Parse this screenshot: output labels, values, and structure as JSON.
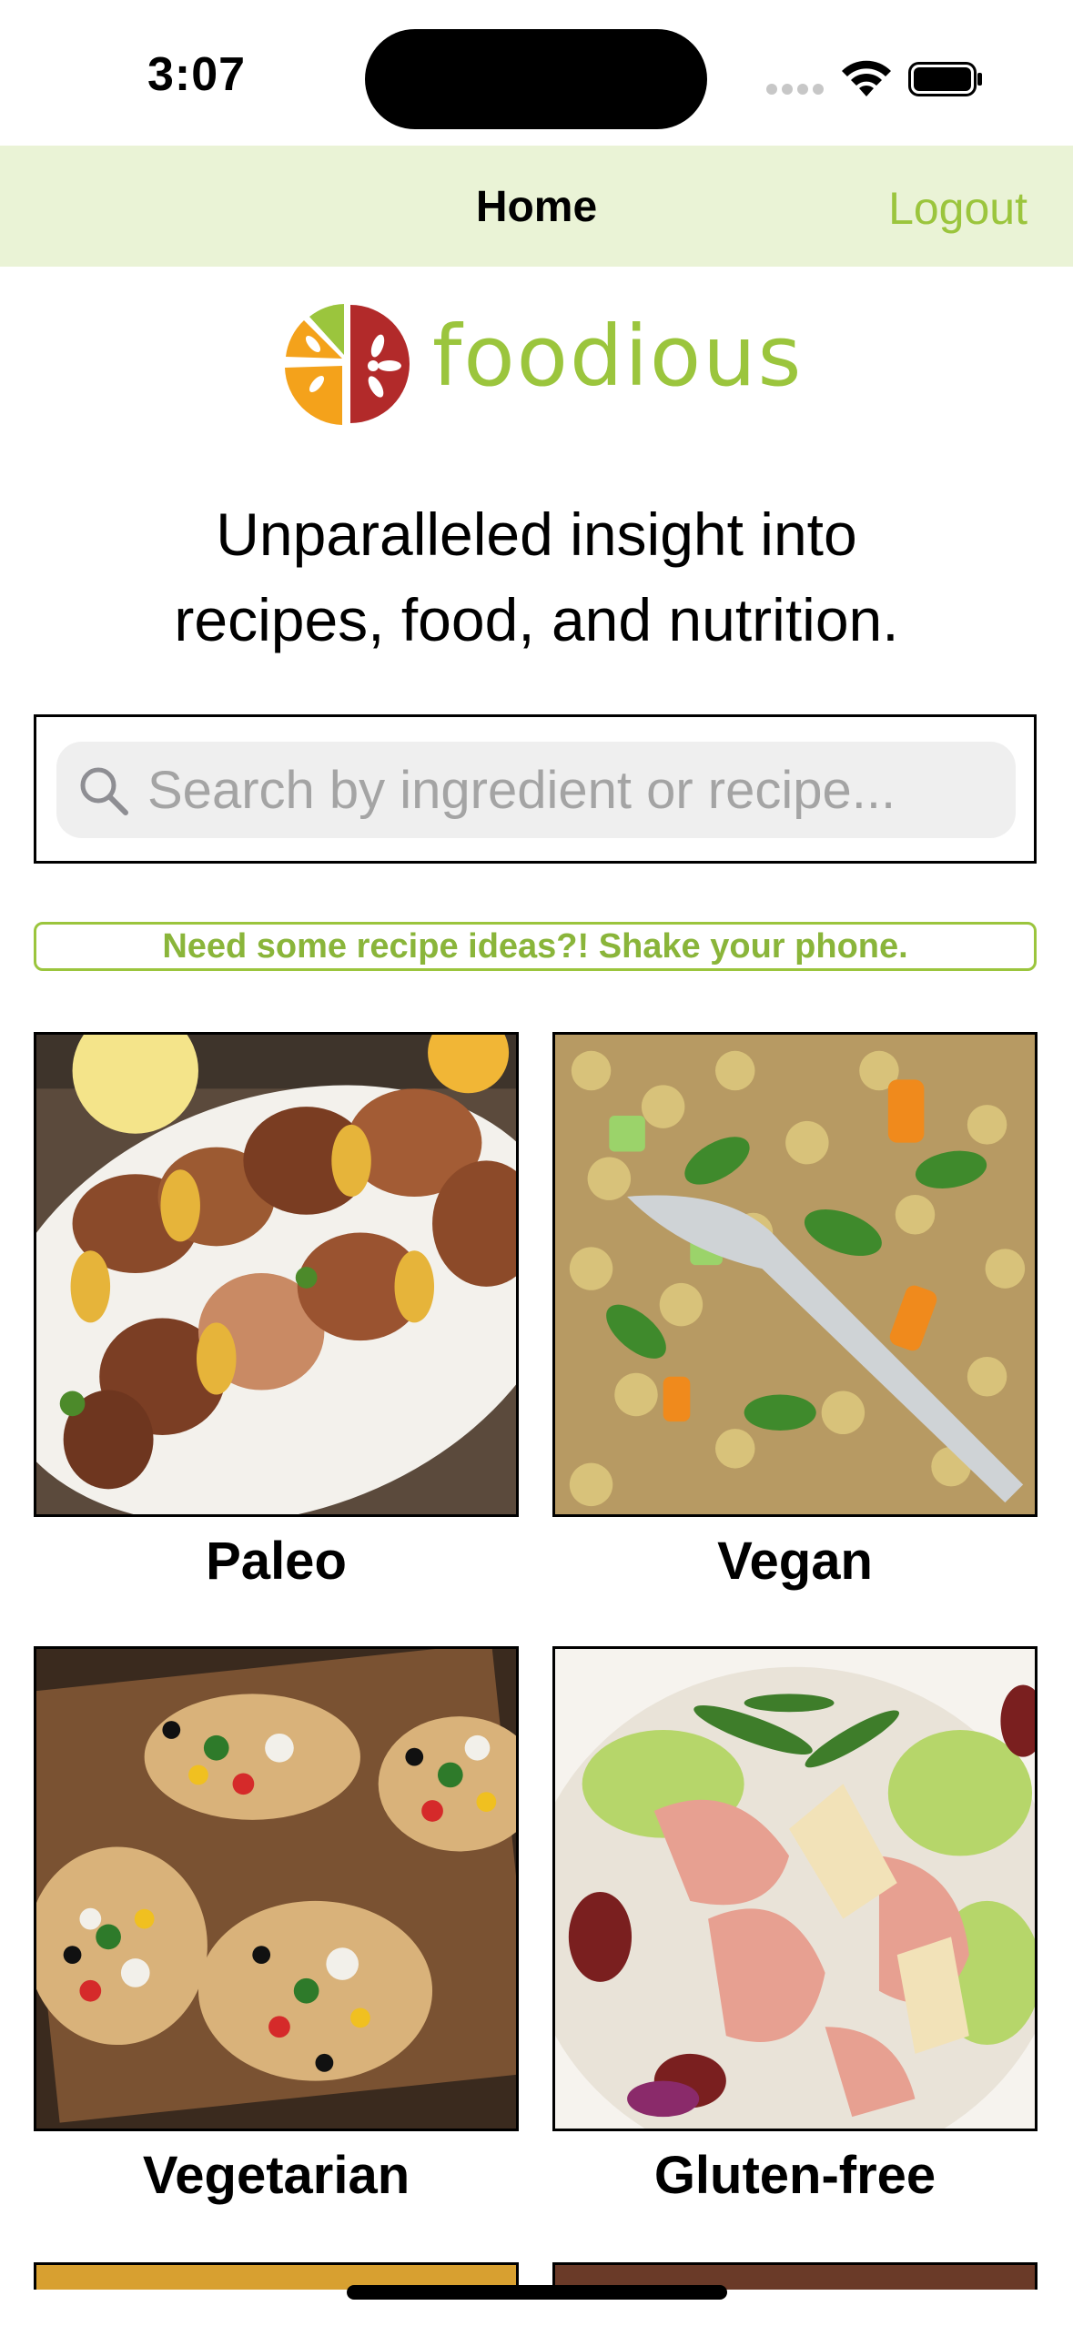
{
  "status_bar": {
    "time": "3:07"
  },
  "nav": {
    "title": "Home",
    "logout_label": "Logout"
  },
  "logo": {
    "text": "foodious"
  },
  "tagline": {
    "line1": "Unparalleled insight into",
    "line2": "recipes, food, and nutrition."
  },
  "search": {
    "placeholder": "Search by ingredient or recipe..."
  },
  "banner": {
    "text": "Need some recipe ideas?! Shake your phone."
  },
  "categories": [
    {
      "label": "Paleo"
    },
    {
      "label": "Vegan"
    },
    {
      "label": "Vegetarian"
    },
    {
      "label": "Gluten-free"
    }
  ],
  "colors": {
    "accent": "#9bc53d",
    "nav_background": "#eaf3d6"
  }
}
